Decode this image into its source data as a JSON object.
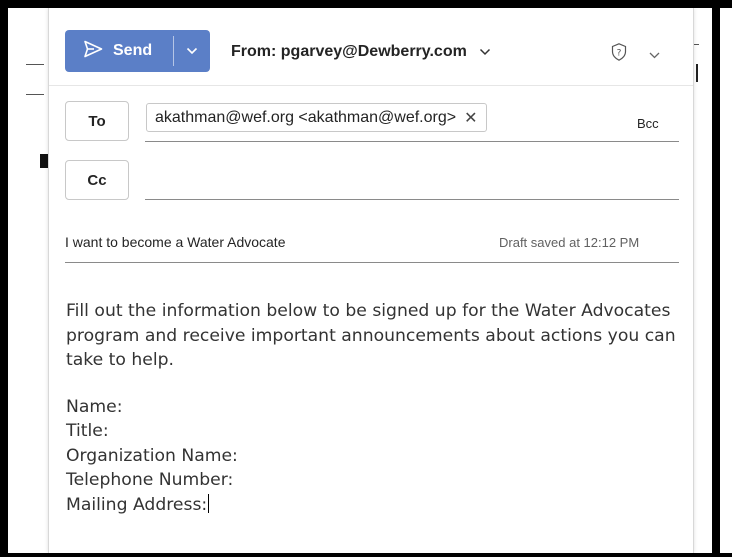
{
  "toolbar": {
    "send_label": "Send",
    "from_label": "From: pgarvey@Dewberry.com"
  },
  "recipients": {
    "to_label": "To",
    "cc_label": "Cc",
    "bcc_label": "Bcc",
    "to_chips": [
      "akathman@wef.org <akathman@wef.org>"
    ]
  },
  "subject": {
    "text": "I want to become a Water Advocate",
    "draft_status": "Draft saved at 12:12 PM"
  },
  "message": {
    "intro": "Fill out the information below to be signed up for the Water Advocates program and receive important announcements about actions you can take to help.",
    "fields": [
      "Name:",
      "Title:",
      "Organization Name:",
      "Telephone Number:",
      "Mailing Address:"
    ]
  },
  "colors": {
    "send_button": "#5b7fc7",
    "frame": "#000000"
  },
  "icons": {
    "send": "send-paper-plane-icon",
    "dropdown": "chevron-down-icon",
    "sensitivity": "sensitivity-icon",
    "remove": "close-icon"
  }
}
